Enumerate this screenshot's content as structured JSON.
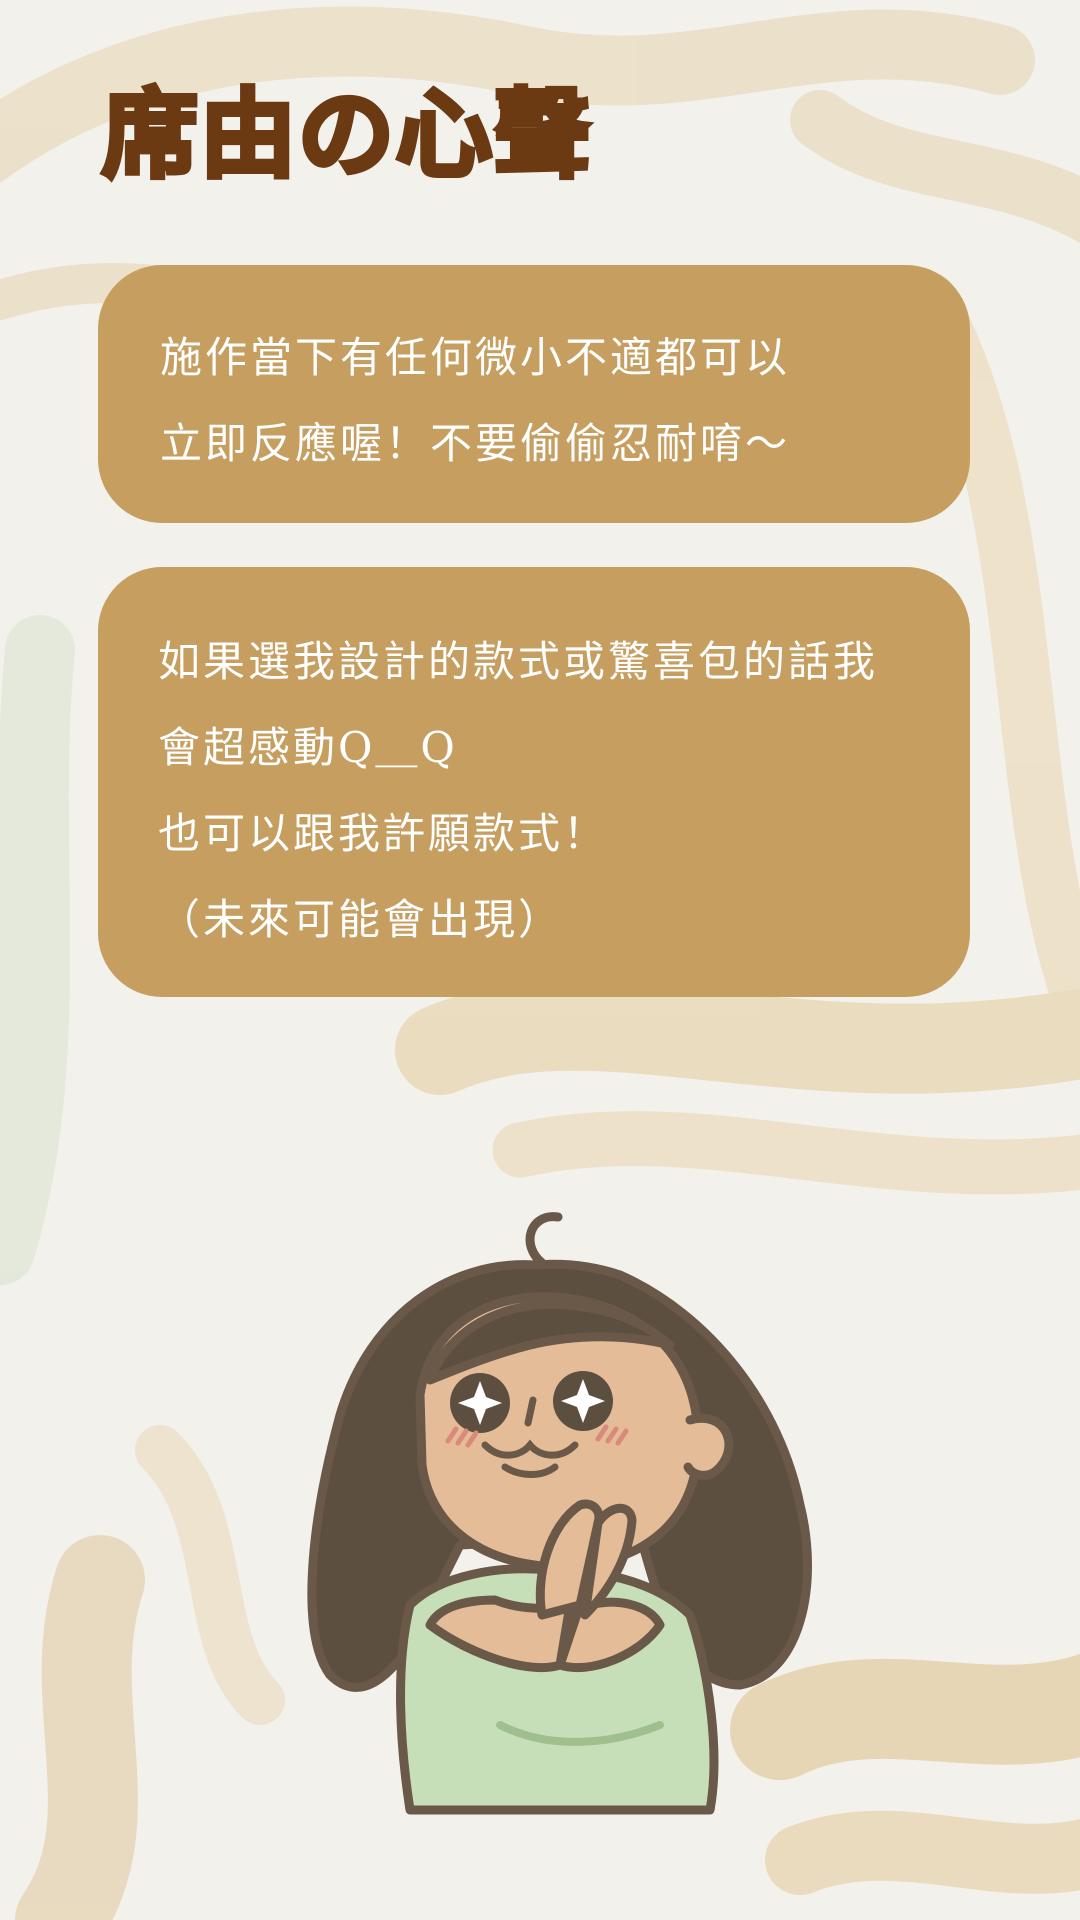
{
  "title": "席由の心聲",
  "bubbles": [
    {
      "lines": [
        "施作當下有任何微小不適都可以",
        "立即反應喔！不要偷偷忍耐唷～"
      ]
    },
    {
      "lines": [
        "如果選我設計的款式或驚喜包的話我",
        "會超感動Q＿Q",
        "也可以跟我許願款式！",
        "（未來可能會出現）"
      ]
    }
  ],
  "colors": {
    "title": "#6b3a12",
    "bubble": "#c69e60",
    "bubble_text": "#ffffff",
    "background": "#f3f1ec",
    "paint_stroke": "#e9dcc0"
  }
}
